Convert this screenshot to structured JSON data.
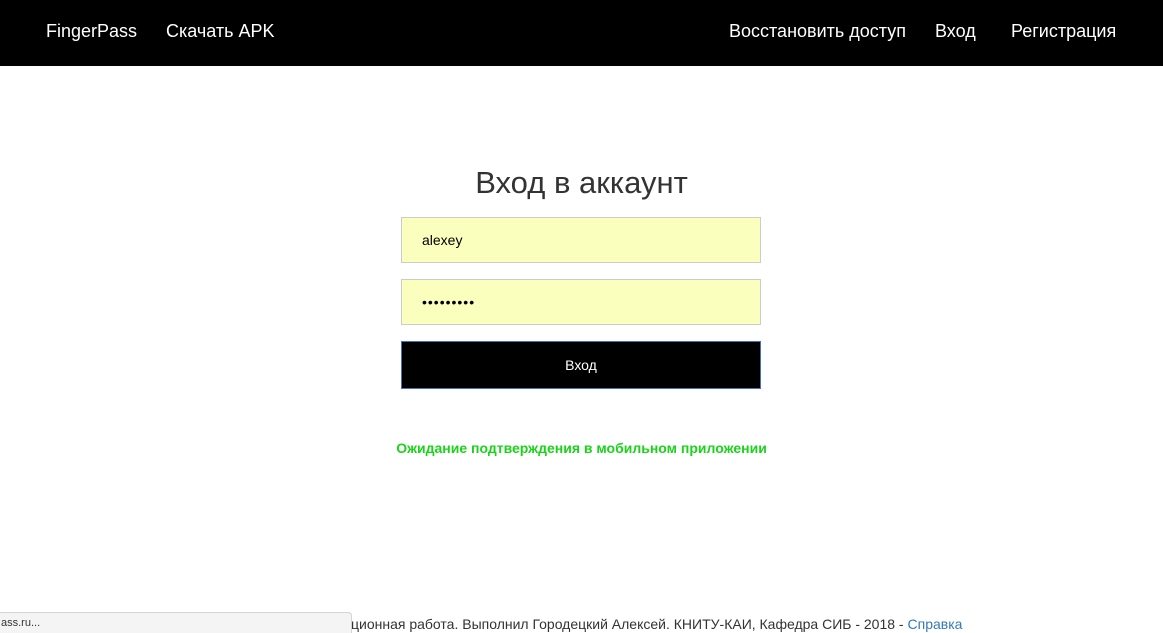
{
  "navbar": {
    "brand": "FingerPass",
    "download": "Скачать APK",
    "restore": "Восстановить доступ",
    "login": "Вход",
    "register": "Регистрация"
  },
  "form": {
    "title": "Вход в аккаунт",
    "login_value": "alexey",
    "password_mask": "•••••••••",
    "submit_label": "Вход"
  },
  "status_message": "Ожидание подтверждения в мобильном приложении",
  "footer": {
    "text": "ционная работа. Выполнил Городецкий Алексей. КНИТУ-КАИ, Кафедра СИБ - 2018 - ",
    "link": "Справка"
  },
  "browser_status_url": "ass.ru...",
  "colors": {
    "navbar_bg": "#000000",
    "field_bg": "#faffbd",
    "status_green": "#1ad31a",
    "link_blue": "#337ab7"
  }
}
